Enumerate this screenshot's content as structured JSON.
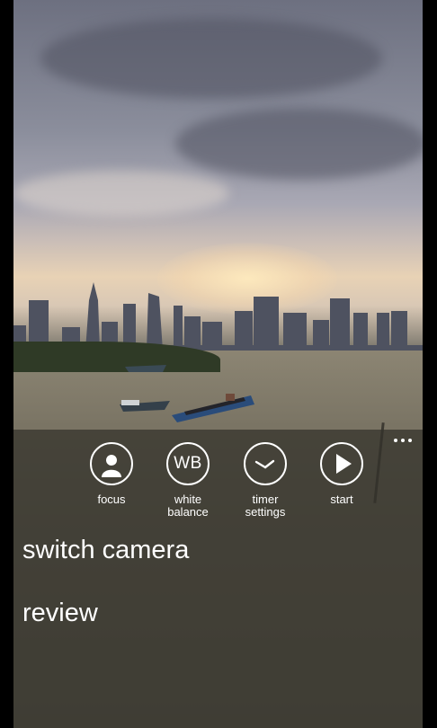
{
  "app_bar": {
    "actions": [
      {
        "label": "focus",
        "icon": "focus-person-icon"
      },
      {
        "label": "white\nbalance",
        "icon": "white-balance-icon",
        "icon_text": "WB"
      },
      {
        "label": "timer\nsettings",
        "icon": "timer-clock-icon"
      },
      {
        "label": "start",
        "icon": "play-icon"
      }
    ],
    "more_icon": "ellipsis-icon"
  },
  "menu": {
    "switch_camera": "switch camera",
    "review": "review"
  }
}
